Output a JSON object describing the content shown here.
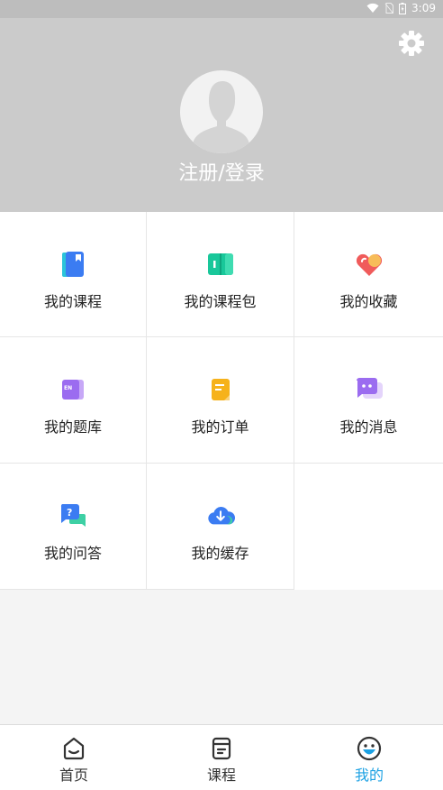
{
  "status_bar": {
    "time": "3:09"
  },
  "header": {
    "login_label": "注册/登录"
  },
  "menu": [
    {
      "label": "我的课程",
      "icon": "course-book-icon"
    },
    {
      "label": "我的课程包",
      "icon": "course-package-icon"
    },
    {
      "label": "我的收藏",
      "icon": "favorite-heart-icon"
    },
    {
      "label": "我的题库",
      "icon": "question-bank-icon"
    },
    {
      "label": "我的订单",
      "icon": "order-note-icon"
    },
    {
      "label": "我的消息",
      "icon": "message-chat-icon"
    },
    {
      "label": "我的问答",
      "icon": "qa-bubble-icon"
    },
    {
      "label": "我的缓存",
      "icon": "cache-download-icon"
    }
  ],
  "tabs": [
    {
      "label": "首页",
      "icon": "home-icon"
    },
    {
      "label": "课程",
      "icon": "course-icon"
    },
    {
      "label": "我的",
      "icon": "profile-smile-icon",
      "active": true
    }
  ],
  "colors": {
    "header_bg": "#cbcbcb",
    "active_tab": "#1ca1e3"
  }
}
